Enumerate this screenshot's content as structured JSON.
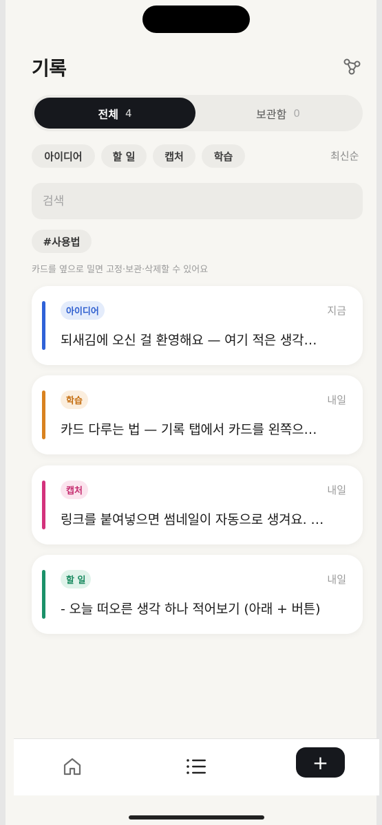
{
  "header": {
    "title": "기록"
  },
  "segments": [
    {
      "label": "전체",
      "count": "4"
    },
    {
      "label": "보관함",
      "count": "0"
    }
  ],
  "filters": [
    "아이디어",
    "할 일",
    "캡처",
    "학습"
  ],
  "sort_label": "최신순",
  "search": {
    "placeholder": "검색",
    "value": ""
  },
  "tag_filter": "#사용법",
  "hint": "카드를 옆으로 밀면 고정·보관·삭제할 수 있어요",
  "cards": [
    {
      "category": "아이디어",
      "time": "지금",
      "text": "되새김에 오신 걸 환영해요 — 여기 적은 생각…",
      "color": "#2f62d8",
      "badge_bg": "#e4ecfb",
      "badge_fg": "#2f5fcf"
    },
    {
      "category": "학습",
      "time": "내일",
      "text": "카드 다루는 법 — 기록 탭에서 카드를 왼쪽으…",
      "color": "#d9821f",
      "badge_bg": "#fbeede",
      "badge_fg": "#c56f12"
    },
    {
      "category": "캡처",
      "time": "내일",
      "text": "링크를 붙여넣으면 썸네일이 자동으로 생겨요. …",
      "color": "#d3327c",
      "badge_bg": "#fbe4ee",
      "badge_fg": "#c42a6e"
    },
    {
      "category": "할 일",
      "time": "내일",
      "text": "- 오늘 떠오른 생각 하나 적어보기 (아래 + 버튼)",
      "color": "#1a9169",
      "badge_bg": "#e0f3ea",
      "badge_fg": "#1a8a60"
    }
  ],
  "nav": {
    "home_icon": "home-icon",
    "list_icon": "list-icon",
    "add_label": "+"
  }
}
